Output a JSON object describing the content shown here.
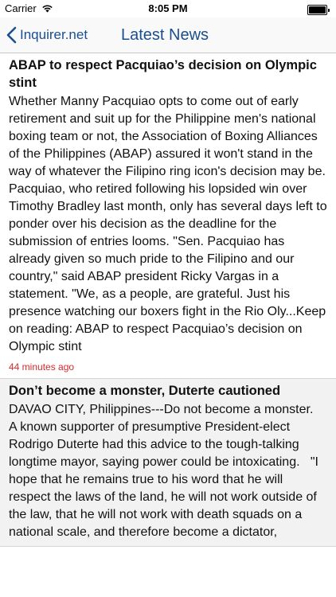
{
  "status_bar": {
    "carrier": "Carrier",
    "time": "8:05 PM",
    "battery_level": 1.0,
    "icons": [
      "wifi-icon",
      "battery-icon"
    ]
  },
  "nav": {
    "back_label": "Inquirer.net",
    "title": "Latest News",
    "accent_color": "#1a4f8f"
  },
  "articles": [
    {
      "title": "ABAP to respect Pacquiao’s decision on Olympic stint",
      "body": "Whether Manny Pacquiao opts to come out of early retirement and suit up for the Philippine men's national boxing team or not, the Association of Boxing Alliances of the Philippines (ABAP) assured it won't stand in the way of whatever the Filipino ring icon's decision may be. Pacquiao, who retired following his lopsided win over Timothy Bradley last month, only has several days left to ponder over his decision as the deadline for the submission of entries looms. \"Sen. Pacquiao has already given so much pride to the Filipino and our country,\" said ABAP president Ricky Vargas in a statement. \"We, as a people, are grateful. Just his presence watching our boxers fight in the Rio Oly...Keep on reading: ABAP to respect Pacquiao’s decision on Olympic stint",
      "time": "44 minutes ago"
    },
    {
      "title": "Don’t become a monster, Duterte cautioned",
      "body": "DAVAO CITY, Philippines---Do not become a monster.   A known supporter of presumptive President-elect Rodrigo Duterte had this advice to the tough-talking longtime mayor, saying power could be intoxicating.   \"I hope that he remains true to his word that he will respect the laws of the land, he will not work outside of the law, that he will not work with death squads on a national scale, and therefore become a dictator,",
      "time": ""
    }
  ],
  "colors": {
    "time_label": "#d62a2a",
    "alt_row_bg": "#f2f2f2"
  }
}
